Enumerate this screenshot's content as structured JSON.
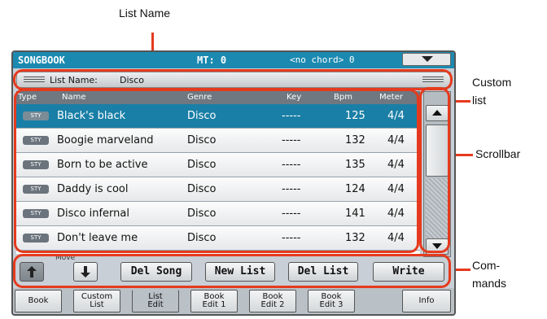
{
  "annotations": {
    "list_name": "List Name",
    "custom_list_1": "Custom",
    "custom_list_2": "list",
    "scrollbar": "Scrollbar",
    "commands_1": "Com-",
    "commands_2": "mands"
  },
  "titlebar": {
    "title": "SONGBOOK",
    "mt": "MT: 0",
    "chord": "<no chord> 0"
  },
  "list_name_bar": {
    "label": "List Name:",
    "value": "Disco"
  },
  "table": {
    "headers": [
      "Type",
      "Name",
      "Genre",
      "Key",
      "Bpm",
      "Meter"
    ],
    "rows": [
      {
        "type": "STY",
        "name": "Black's black",
        "genre": "Disco",
        "key": "-----",
        "bpm": "125",
        "meter": "4/4",
        "selected": true
      },
      {
        "type": "STY",
        "name": "Boogie marveland",
        "genre": "Disco",
        "key": "-----",
        "bpm": "132",
        "meter": "4/4",
        "selected": false
      },
      {
        "type": "STY",
        "name": "Born to be active",
        "genre": "Disco",
        "key": "-----",
        "bpm": "135",
        "meter": "4/4",
        "selected": false
      },
      {
        "type": "STY",
        "name": "Daddy is cool",
        "genre": "Disco",
        "key": "-----",
        "bpm": "124",
        "meter": "4/4",
        "selected": false
      },
      {
        "type": "STY",
        "name": "Disco infernal",
        "genre": "Disco",
        "key": "-----",
        "bpm": "141",
        "meter": "4/4",
        "selected": false
      },
      {
        "type": "STY",
        "name": "Don't leave me",
        "genre": "Disco",
        "key": "-----",
        "bpm": "132",
        "meter": "4/4",
        "selected": false
      }
    ]
  },
  "commands": {
    "move_label": "Move",
    "del_song": "Del Song",
    "new_list": "New List",
    "del_list": "Del List",
    "write": "Write"
  },
  "tabs": [
    {
      "line1": "Book",
      "line2": ""
    },
    {
      "line1": "Custom",
      "line2": "List"
    },
    {
      "line1": "List",
      "line2": "Edit"
    },
    {
      "line1": "Book",
      "line2": "Edit 1"
    },
    {
      "line1": "Book",
      "line2": "Edit 2"
    },
    {
      "line1": "Book",
      "line2": "Edit 3"
    },
    {
      "line1": "Info",
      "line2": ""
    }
  ],
  "colors": {
    "accent": "#1c8ab0",
    "selection": "#1a7fa6",
    "annotation": "#e53a1e"
  }
}
